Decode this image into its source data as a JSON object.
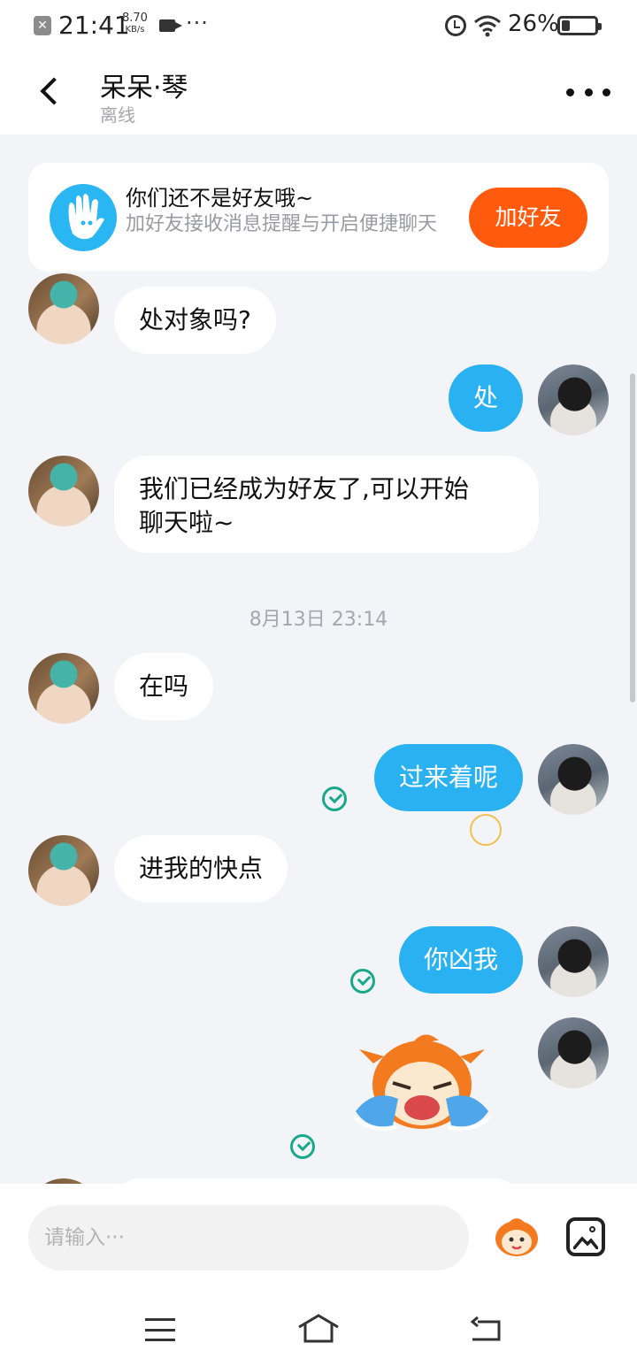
{
  "status_bar": {
    "close_glyph": "✕",
    "time": "21:41",
    "speed_value": "8.70",
    "speed_unit": "KB/s",
    "more_glyph": "···",
    "battery_text": "26%",
    "battery_level": 0.26,
    "icons": [
      "notification-close-icon",
      "video-icon",
      "alarm-icon",
      "wifi-icon",
      "battery-icon"
    ]
  },
  "header": {
    "title": "呆呆·琴",
    "status": "离线",
    "icons": [
      "back-arrow-icon",
      "more-dots-icon"
    ]
  },
  "banner": {
    "title": "你们还不是好友哦~",
    "text": "加好友接收消息提醒与开启便捷聊天",
    "button_label": "加好友",
    "icon": "hand-wave-icon"
  },
  "messages": [
    {
      "side": "in",
      "text": "处对象吗?"
    },
    {
      "side": "out",
      "text": "处"
    },
    {
      "side": "in",
      "text_line1": "我们已经成为好友了,可以开始",
      "text_line2": "聊天啦~"
    },
    {
      "type": "time",
      "text": "8月13日 23:14"
    },
    {
      "side": "in",
      "text": "在吗"
    },
    {
      "side": "out",
      "text": "过来着呢",
      "read": true
    },
    {
      "side": "in",
      "text": "进我的快点"
    },
    {
      "side": "out",
      "text": "你凶我",
      "read": true
    },
    {
      "side": "out",
      "type": "sticker",
      "sticker": "crying-orange-fox-sticker",
      "read": true
    }
  ],
  "input_bar": {
    "placeholder": "请输入···",
    "value": "",
    "icons": [
      "emoji-sticker-icon",
      "image-icon"
    ]
  },
  "nav_bar": {
    "icons": [
      "menu-icon",
      "home-icon",
      "back-icon"
    ]
  },
  "colors": {
    "accent_blue": "#2ab1f2",
    "add_button": "#ff5a0e",
    "read_check": "#17a98a",
    "chat_background": "#f3f4f8"
  }
}
